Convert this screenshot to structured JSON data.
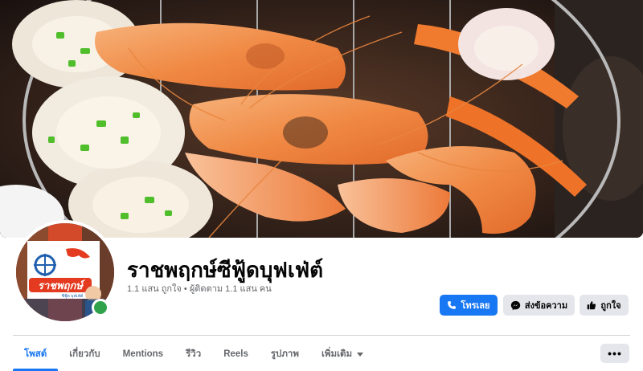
{
  "page": {
    "name": "ราชพฤกษ์ซีฟู้ดบุฟเฟ่ต์",
    "stats": "1.1 แสน ถูกใจ • ผู้ติดตาม 1.1 แสน คน"
  },
  "profile": {
    "logo_text": "ราชพฤกษ์",
    "logo_subtext": "ซีฟู้ด บุฟเฟ่ต์",
    "online": true
  },
  "actions": {
    "call_label": "โทรเลย",
    "message_label": "ส่งข้อความ",
    "like_label": "ถูกใจ"
  },
  "tabs": [
    {
      "label": "โพสต์",
      "active": true
    },
    {
      "label": "เกี่ยวกับ",
      "active": false
    },
    {
      "label": "Mentions",
      "active": false
    },
    {
      "label": "รีวิว",
      "active": false
    },
    {
      "label": "Reels",
      "active": false
    },
    {
      "label": "รูปภาพ",
      "active": false
    },
    {
      "label": "เพิ่มเติม",
      "active": false
    }
  ],
  "more_button_label": "•••",
  "colors": {
    "accent": "#1877f2",
    "secondary_button": "#e4e6eb",
    "muted_text": "#65676b",
    "online": "#31a24c"
  },
  "icons": {
    "call": "phone-icon",
    "message": "messenger-icon",
    "like": "thumbs-up-icon",
    "dropdown": "caret-down-icon",
    "more": "more-horizontal-icon"
  }
}
